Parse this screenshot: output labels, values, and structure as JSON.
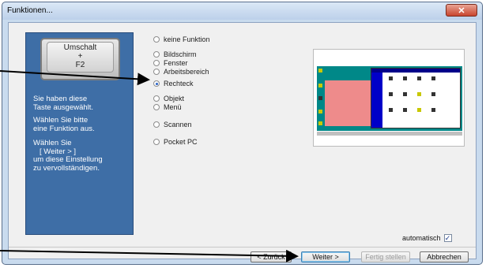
{
  "window": {
    "title": "Funktionen...",
    "close_glyph": "✕"
  },
  "sidebar": {
    "key_line1": "Umschalt",
    "key_line2": "+",
    "key_line3": "F2",
    "paragraph1": [
      "Sie haben diese",
      "Taste ausgewählt."
    ],
    "paragraph2": [
      "Wählen Sie bitte",
      "eine Funktion aus."
    ],
    "paragraph3": [
      "Wählen Sie",
      "[ Weiter > ]",
      "um diese Einstellung",
      "zu vervollständigen."
    ]
  },
  "options": [
    {
      "label": "keine Funktion",
      "selected": false
    },
    {
      "label": "Bildschirm",
      "selected": false
    },
    {
      "label": "Fenster",
      "selected": false
    },
    {
      "label": "Arbeitsbereich",
      "selected": false
    },
    {
      "label": "Rechteck",
      "selected": true
    },
    {
      "label": "Objekt",
      "selected": false
    },
    {
      "label": "Menü",
      "selected": false
    },
    {
      "label": "Scannen",
      "selected": false
    },
    {
      "label": "Pocket PC",
      "selected": false
    }
  ],
  "automatic": {
    "label": "automatisch",
    "checked": true,
    "check_glyph": "✓"
  },
  "buttons": {
    "back": "< Zurück",
    "next": "Weiter >",
    "finish": "Fertig stellen",
    "cancel": "Abbrechen"
  },
  "colors": {
    "sidebar": "#3e6ea6",
    "arrow": "#000000",
    "selection": "#2a63c8"
  },
  "icons": {
    "radio": "radio-icon",
    "checkbox": "checkbox-icon",
    "close": "close-icon"
  }
}
